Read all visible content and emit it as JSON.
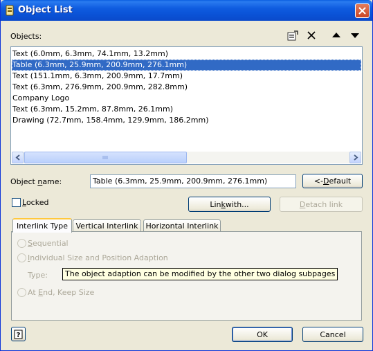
{
  "window": {
    "title": "Object List"
  },
  "objects_label": "Objects:",
  "toolbar": {
    "properties_icon": "properties-icon",
    "delete_icon": "delete-x-icon",
    "move_up_icon": "arrow-up-icon",
    "move_down_icon": "arrow-down-icon"
  },
  "objects": [
    {
      "label": "Text (6.0mm, 6.3mm, 74.1mm, 13.2mm)",
      "selected": false
    },
    {
      "label": "Table (6.3mm, 25.9mm, 200.9mm, 276.1mm)",
      "selected": true
    },
    {
      "label": "Text (151.1mm, 6.3mm, 200.9mm, 17.7mm)",
      "selected": false
    },
    {
      "label": "Text (6.3mm, 276.9mm, 200.9mm, 282.8mm)",
      "selected": false
    },
    {
      "label": "Company Logo",
      "selected": false
    },
    {
      "label": "Text (6.3mm, 15.2mm, 87.8mm, 26.1mm)",
      "selected": false
    },
    {
      "label": "Drawing (72.7mm, 158.4mm, 129.9mm, 186.2mm)",
      "selected": false
    }
  ],
  "object_name": {
    "label_pre": "Object ",
    "label_ul": "n",
    "label_post": "ame:",
    "value": "Table (6.3mm, 25.9mm, 200.9mm, 276.1mm)"
  },
  "default_button": {
    "pre": "<- ",
    "ul": "D",
    "post": "efault"
  },
  "locked": {
    "ul": "L",
    "post": "ocked",
    "checked": false
  },
  "link_button": {
    "pre": "Lin",
    "ul": "k",
    "post": " with..."
  },
  "detach_button": {
    "ul": "D",
    "post": "etach link"
  },
  "tabs": [
    {
      "label": "Interlink Type",
      "active": true
    },
    {
      "label": "Vertical Interlink",
      "active": false
    },
    {
      "label": "Horizontal Interlink",
      "active": false
    }
  ],
  "radios": {
    "sequential": {
      "ul": "S",
      "post": "equential"
    },
    "individual": {
      "ul": "I",
      "post": "ndividual Size and Position Adaption"
    },
    "type_label": "Type:",
    "at_end": {
      "pre": "At ",
      "ul": "E",
      "post": "nd, Keep Size"
    }
  },
  "tooltip": "The object adaption can be modified by the other two dialog subpages",
  "ok_button": "OK",
  "cancel_button": "Cancel",
  "help_icon": "help-question-icon",
  "colors": {
    "selection": "#316ac5",
    "titlebar": "#0a52d6",
    "dialog_bg": "#ece9d8"
  }
}
